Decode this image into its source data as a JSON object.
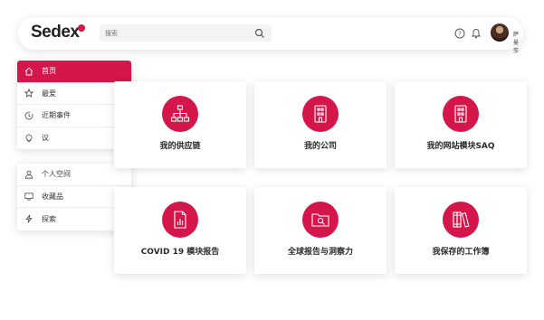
{
  "header": {
    "logo_text": "Sedex",
    "search_placeholder": "搜索",
    "username": "萨曼莎",
    "accent_color": "#d4164a"
  },
  "menu_primary": [
    {
      "label": "首页",
      "icon": "home-icon",
      "active": true
    },
    {
      "label": "最爱",
      "icon": "star-icon",
      "active": false
    },
    {
      "label": "近期事件",
      "icon": "clock-icon",
      "active": false
    },
    {
      "label": "议",
      "icon": "lightbulb-icon",
      "active": false
    }
  ],
  "menu_secondary": [
    {
      "label": "个人空间",
      "icon": "user-icon"
    },
    {
      "label": "收藏品",
      "icon": "monitor-icon"
    },
    {
      "label": "探索",
      "icon": "lightning-icon"
    }
  ],
  "cards": [
    {
      "label": "我的供应链",
      "icon": "org-chart-icon"
    },
    {
      "label": "我的公司",
      "icon": "building-icon"
    },
    {
      "label": "我的网站模块SAQ",
      "icon": "office-icon"
    },
    {
      "label": "COVID 19 模块报告",
      "icon": "report-icon"
    },
    {
      "label": "全球报告与洞察力",
      "icon": "folder-search-icon"
    },
    {
      "label": "我保存的工作簿",
      "icon": "books-icon"
    }
  ]
}
